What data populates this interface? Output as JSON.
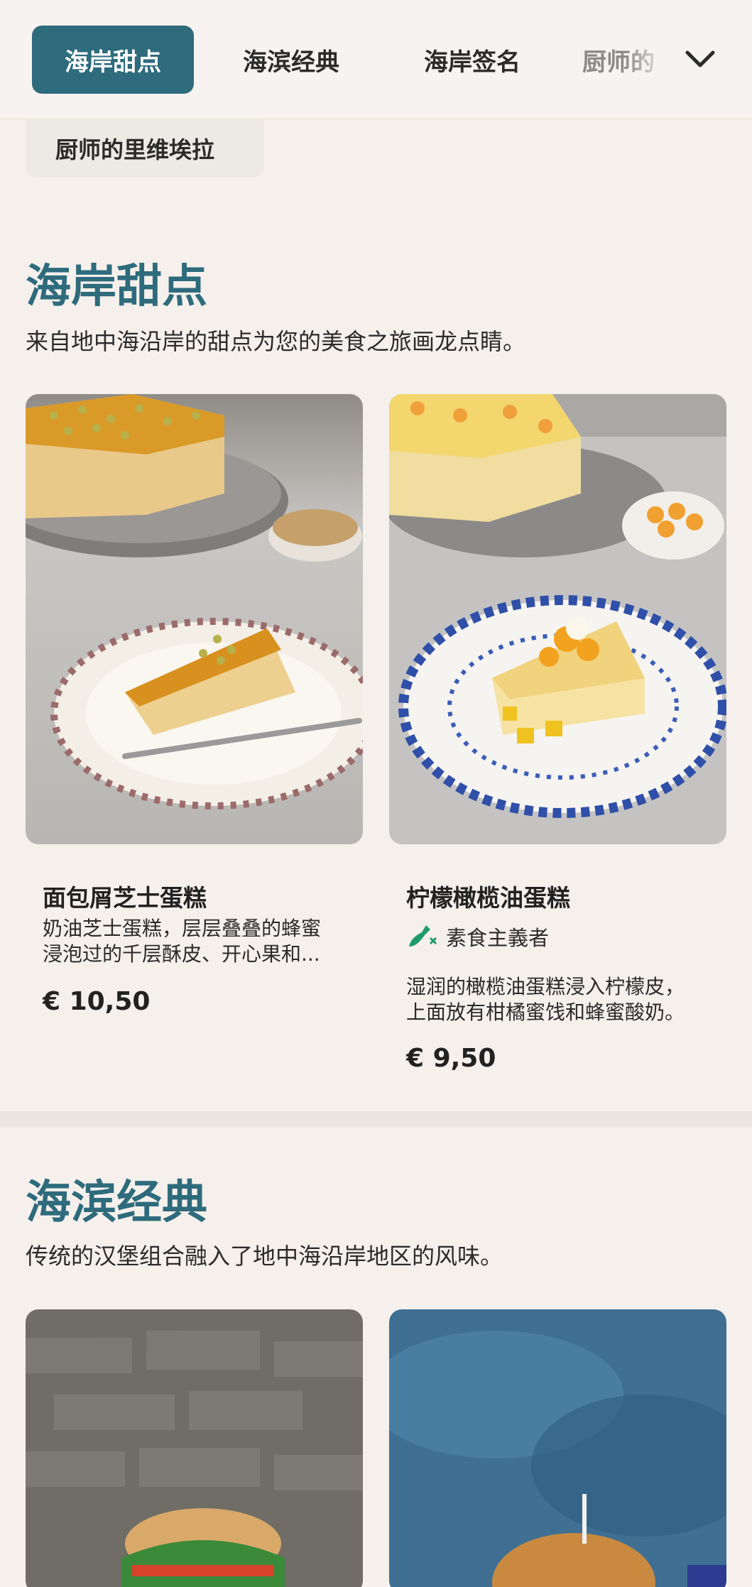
{
  "nav": {
    "tabs": [
      "海岸甜点",
      "海滨经典",
      "海岸签名",
      "厨师的"
    ],
    "active_tab": 0,
    "overflow_pill": "厨师的里维埃拉"
  },
  "sections": [
    {
      "title": "海岸甜点",
      "description": "来自地中海沿岸的甜点为您的美食之旅画龙点睛。",
      "items": [
        {
          "name": "面包屑芝士蛋糕",
          "description_line1": "奶油芝士蛋糕，层层叠叠的蜂蜜",
          "description_line2": "浸泡过的千层酥皮、开心果和...",
          "price": "€ 10,50"
        },
        {
          "name": "柠檬橄榄油蛋糕",
          "badge": "素食主義者",
          "description_line1": "湿润的橄榄油蛋糕浸入柠檬皮，",
          "description_line2": "上面放有柑橘蜜饯和蜂蜜酸奶。",
          "price": "€ 9,50"
        }
      ]
    },
    {
      "title": "海滨经典",
      "description": "传统的汉堡组合融入了地中海沿岸地区的风味。"
    }
  ],
  "colors": {
    "accent": "#2e6b7c",
    "background": "#f5f0ec",
    "vegan_badge": "#1f9a6a"
  }
}
